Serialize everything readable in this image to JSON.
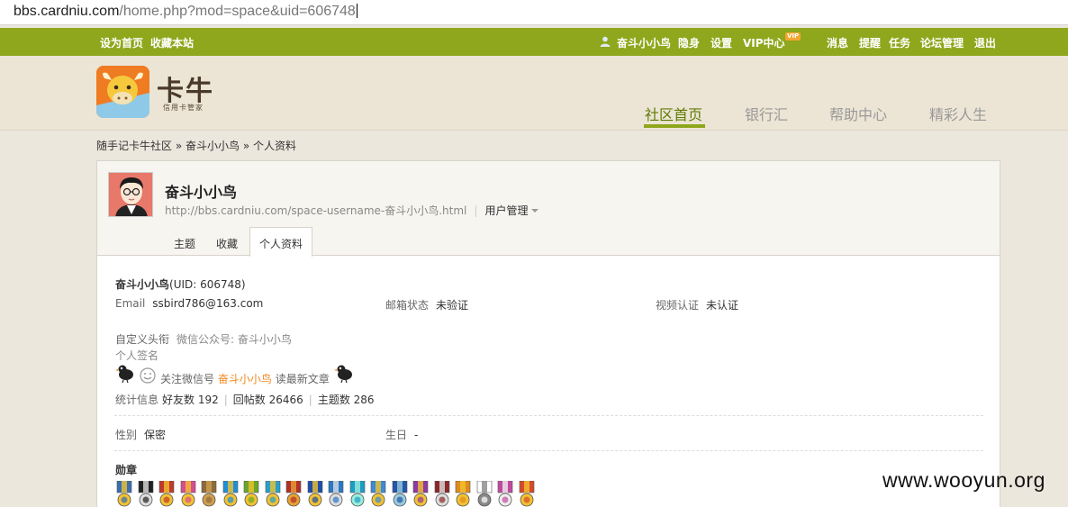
{
  "address_bar": {
    "host": "bbs.cardniu.com",
    "path": "/home.php?mod=space&uid=606748"
  },
  "topnav": {
    "set_home": "设为首页",
    "bookmark": "收藏本站",
    "username": "奋斗小小鸟",
    "stealth": "隐身",
    "settings": "设置",
    "vip": "VIP中心",
    "vip_badge": "VIP",
    "messages": "消息",
    "reminders": "提醒",
    "tasks": "任务",
    "forum_admin": "论坛管理",
    "logout": "退出"
  },
  "logo": {
    "title": "卡牛",
    "subtitle": "信用卡管家"
  },
  "mainnav": [
    {
      "label": "社区首页",
      "active": true
    },
    {
      "label": "银行汇",
      "active": false
    },
    {
      "label": "帮助中心",
      "active": false
    },
    {
      "label": "精彩人生",
      "active": false
    }
  ],
  "breadcrumb": {
    "root": "随手记卡牛社区",
    "sep1": " » ",
    "user": "奋斗小小鸟",
    "sep2": " » ",
    "page": "个人资料"
  },
  "profile": {
    "name": "奋斗小小鸟",
    "url": "http://bbs.cardniu.com/space-username-奋斗小小鸟.html",
    "user_mgmt": "用户管理",
    "tabs": [
      "主题",
      "收藏",
      "个人资料"
    ],
    "name_uid": "奋斗小小鸟",
    "uid_text": "(UID: 606748)",
    "email_label": "Email",
    "email_value": "ssbird786@163.com",
    "mail_status_label": "邮箱状态",
    "mail_status_value": "未验证",
    "video_label": "视频认证",
    "video_value": "未认证",
    "custom_title_label": "自定义头衔",
    "custom_title_value": "微信公众号: 奋斗小小鸟",
    "signature_label": "个人签名",
    "sig_follow": "关注微信号",
    "sig_name": "奋斗小小鸟",
    "sig_read": "读最新文章",
    "stats_label": "统计信息",
    "friends": "好友数 192",
    "posts": "回帖数 26466",
    "threads": "主题数 286",
    "gender_label": "性别",
    "gender_value": "保密",
    "birthday_label": "生日",
    "birthday_value": "-",
    "medals_label": "勋章"
  },
  "colors": {
    "nav_green": "#8fa71c",
    "accent_green": "#5f7a00",
    "orange": "#f08a22"
  },
  "watermark": "www.wooyun.org"
}
